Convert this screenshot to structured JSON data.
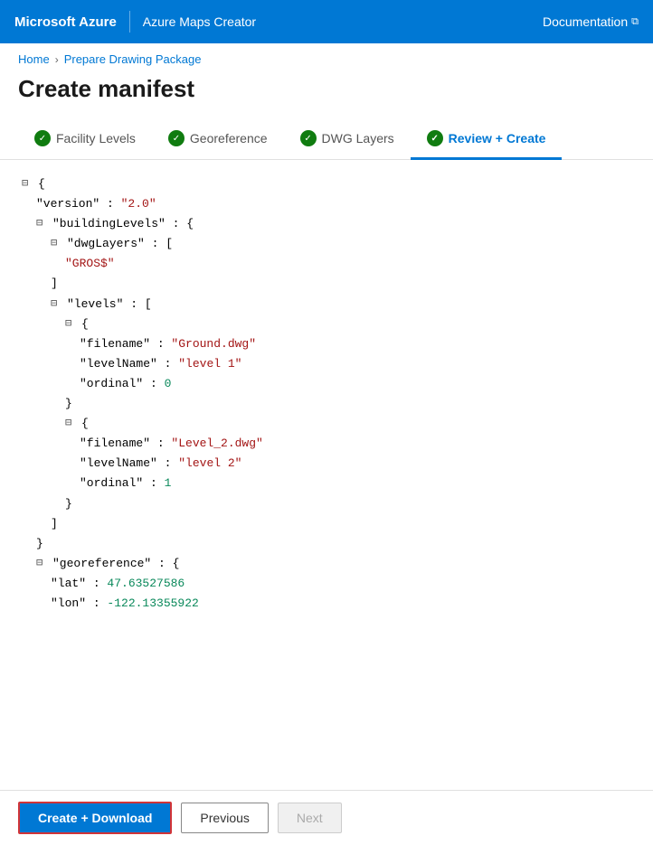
{
  "navbar": {
    "brand": "Microsoft Azure",
    "product": "Azure Maps Creator",
    "doc_label": "Documentation",
    "external_icon": "⧉"
  },
  "breadcrumb": {
    "home": "Home",
    "separator": "›",
    "current": "Prepare Drawing Package"
  },
  "page": {
    "title": "Create manifest"
  },
  "steps": [
    {
      "id": "facility-levels",
      "label": "Facility Levels",
      "checked": true,
      "active": false
    },
    {
      "id": "georeference",
      "label": "Georeference",
      "checked": true,
      "active": false
    },
    {
      "id": "dwg-layers",
      "label": "DWG Layers",
      "checked": true,
      "active": false
    },
    {
      "id": "review-create",
      "label": "Review + Create",
      "checked": true,
      "active": true
    }
  ],
  "json_display": {
    "version_key": "\"version\"",
    "version_value": "\"2.0\"",
    "buildingLevels_key": "\"buildingLevels\"",
    "dwgLayers_key": "\"dwgLayers\"",
    "gros_value": "\"GROS$\"",
    "levels_key": "\"levels\"",
    "filename_key": "\"filename\"",
    "filename1_value": "\"Ground.dwg\"",
    "levelName_key": "\"levelName\"",
    "levelName1_value": "\"level 1\"",
    "ordinal_key": "\"ordinal\"",
    "ordinal1_value": "0",
    "filename2_value": "\"Level_2.dwg\"",
    "levelName2_value": "\"level 2\"",
    "ordinal2_value": "1",
    "georeference_key": "\"georeference\"",
    "lat_key": "\"lat\"",
    "lat_value": "47.63527586",
    "lon_key": "\"lon\"",
    "lon_value": "-122.13355922"
  },
  "footer": {
    "create_label": "Create + Download",
    "previous_label": "Previous",
    "next_label": "Next"
  }
}
